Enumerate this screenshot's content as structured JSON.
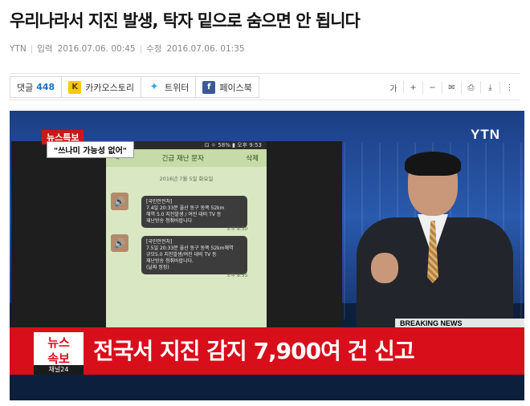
{
  "article": {
    "headline": "우리나라서 지진 발생, 탁자 밑으로 숨으면 안 됩니다",
    "source": "YTN",
    "input_label": "입력",
    "input_time": "2016.07.06. 00:45",
    "edit_label": "수정",
    "edit_time": "2016.07.06. 01:35"
  },
  "share": {
    "comments_label": "댓글",
    "comments_count": "448",
    "kakao_label": "카카오스토리",
    "twitter_label": "트위터",
    "facebook_label": "페이스북"
  },
  "tools": [
    "가",
    "+",
    "−",
    "✉",
    "⎙",
    "⤓",
    "⋮"
  ],
  "video": {
    "brand": "YTN",
    "news_tag": "뉴스특보",
    "quote": "\"쓰나미 가능성 없어\"",
    "phone_status": "⊡ ☼ 58% ▮ 오후 9:53",
    "phone_back": "<",
    "phone_title": "긴급 재난 문자",
    "phone_delete": "삭제",
    "phone_date": "2016년 7월 5일 화요일",
    "msg1_lines": [
      "[국민안전처]",
      "7.4일 20:33분 울산 동구 동쪽 52km",
      "해역 5.0 지진발생 / 여진 대비 TV 등",
      "재난방송 청취바랍니다"
    ],
    "msg1_time": "오후 8:50",
    "msg2_lines": [
      "[국민안전처]",
      "7.5일 20:33분 울산 동구 동쪽 52km해역",
      "규모5.0 지진발생/여진 대비 TV 등",
      "재난방송 청취바랍니다.",
      "(날짜 정정)"
    ],
    "msg2_time": "오후 8:55",
    "breaking": "BREAKING NEWS",
    "ticker_label_1": "뉴스",
    "ticker_label_2": "속보",
    "ticker_text": "전국서 지진 감지 7,900여 건 신고",
    "channel": "채널24"
  }
}
